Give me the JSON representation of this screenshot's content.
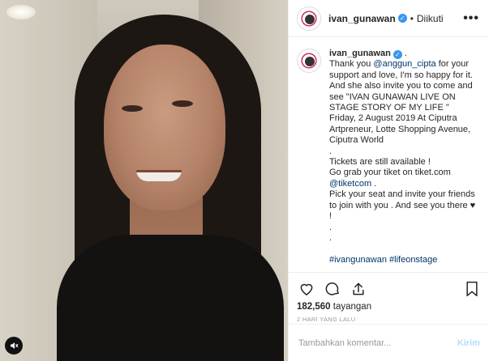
{
  "post": {
    "username": "ivan_gunawan",
    "follow_status": "Diikuti",
    "separator": "•",
    "more_label": "•••"
  },
  "caption": {
    "username": "ivan_gunawan",
    "after_verified": " .",
    "line1_prefix": "Thank you ",
    "mention1": "@anggun_cipta",
    "line1_suffix": " for your support and love, I'm so happy for it. And she also invite you to come and see \"IVAN GUNAWAN LIVE ON STAGE STORY OF MY LIFE \"\nFriday, 2 August 2019 At Ciputra Artpreneur, Lotte Shopping Avenue, Ciputra World\n.\nTickets are still available !\nGo grab your tiket on tiket.com\n",
    "mention2": "@tiketcom",
    "line2_suffix": " .\nPick your seat and invite your friends to join with you . And see you there ",
    "heart": "♥",
    "line3_suffix": " !\n.\n.\n\n",
    "hashtag1": "#ivangunawan",
    "hashtag2": "#lifeonstage"
  },
  "stats": {
    "views": "182,560",
    "views_label": " tayangan",
    "time": "2 HARI YANG LALU"
  },
  "comment": {
    "placeholder": "Tambahkan komentar...",
    "post_label": "Kirim"
  },
  "colors": {
    "verified": "#3897f0",
    "link": "#003569",
    "post_disabled": "#b2dffc"
  },
  "icons": [
    "heart-icon",
    "comment-icon",
    "share-icon",
    "bookmark-icon",
    "sound-icon",
    "verified-icon"
  ]
}
